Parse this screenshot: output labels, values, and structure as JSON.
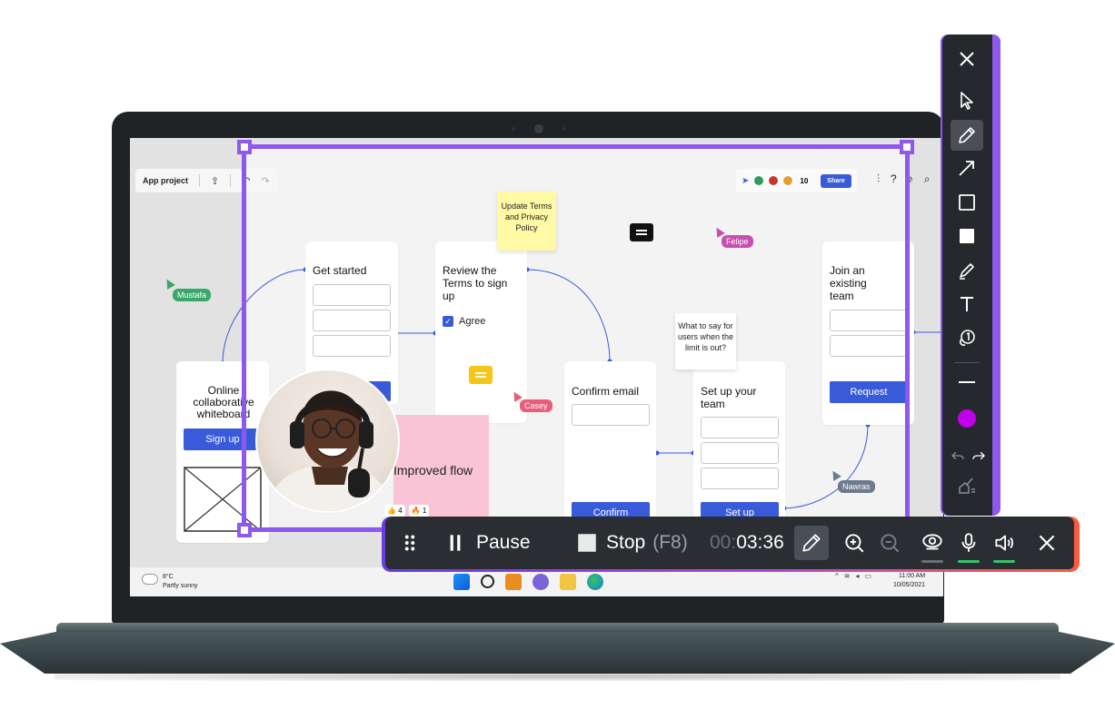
{
  "whiteboard": {
    "project_label": "App project",
    "participants_count": "10",
    "share_label": "Share",
    "cards": {
      "get_started": "Get started",
      "review_terms": "Review the Terms to sign up",
      "agree_label": "Agree",
      "confirm_email": "Confirm email",
      "confirm_button": "Confirm",
      "set_up_team": "Set up your team",
      "set_up_button": "Set up",
      "join_team": "Join an existing team",
      "request_button": "Request",
      "online_whiteboard": "Online collaborative whiteboard",
      "sign_up_button": "Sign up"
    },
    "sticky_update": "Update Terms and Privacy Policy",
    "note_limit": "What to say for users when the limit is out?",
    "pink_note": "Improved flow",
    "reactions": [
      "👍 4",
      "🔥 1"
    ],
    "cursors": [
      {
        "name": "Mustafa",
        "color": "#3aa86b"
      },
      {
        "name": "Felipe",
        "color": "#c84fb2"
      },
      {
        "name": "Casey",
        "color": "#e85d7a"
      },
      {
        "name": "Nawras",
        "color": "#6d7a8c"
      }
    ]
  },
  "taskbar": {
    "temperature": "8°C",
    "weather": "Partly sunny",
    "time": "11:00 AM",
    "date": "10/05/2021"
  },
  "draw_panel": {
    "tools": [
      "close-icon",
      "select-arrow-icon",
      "pencil-icon",
      "arrow-line-icon",
      "rectangle-icon",
      "filled-rectangle-icon",
      "highlighter-icon",
      "text-icon",
      "step-counter-icon",
      "line-width-icon",
      "color-picker",
      "undo-icon",
      "redo-icon",
      "clear-drawings-icon"
    ],
    "active_color": "#c000e8",
    "active_tool": "pencil-icon"
  },
  "recording_bar": {
    "pause_label": "Pause",
    "stop_label": "Stop",
    "stop_hotkey": "(F8)",
    "timer_dim": "00:",
    "timer": "03:36"
  }
}
